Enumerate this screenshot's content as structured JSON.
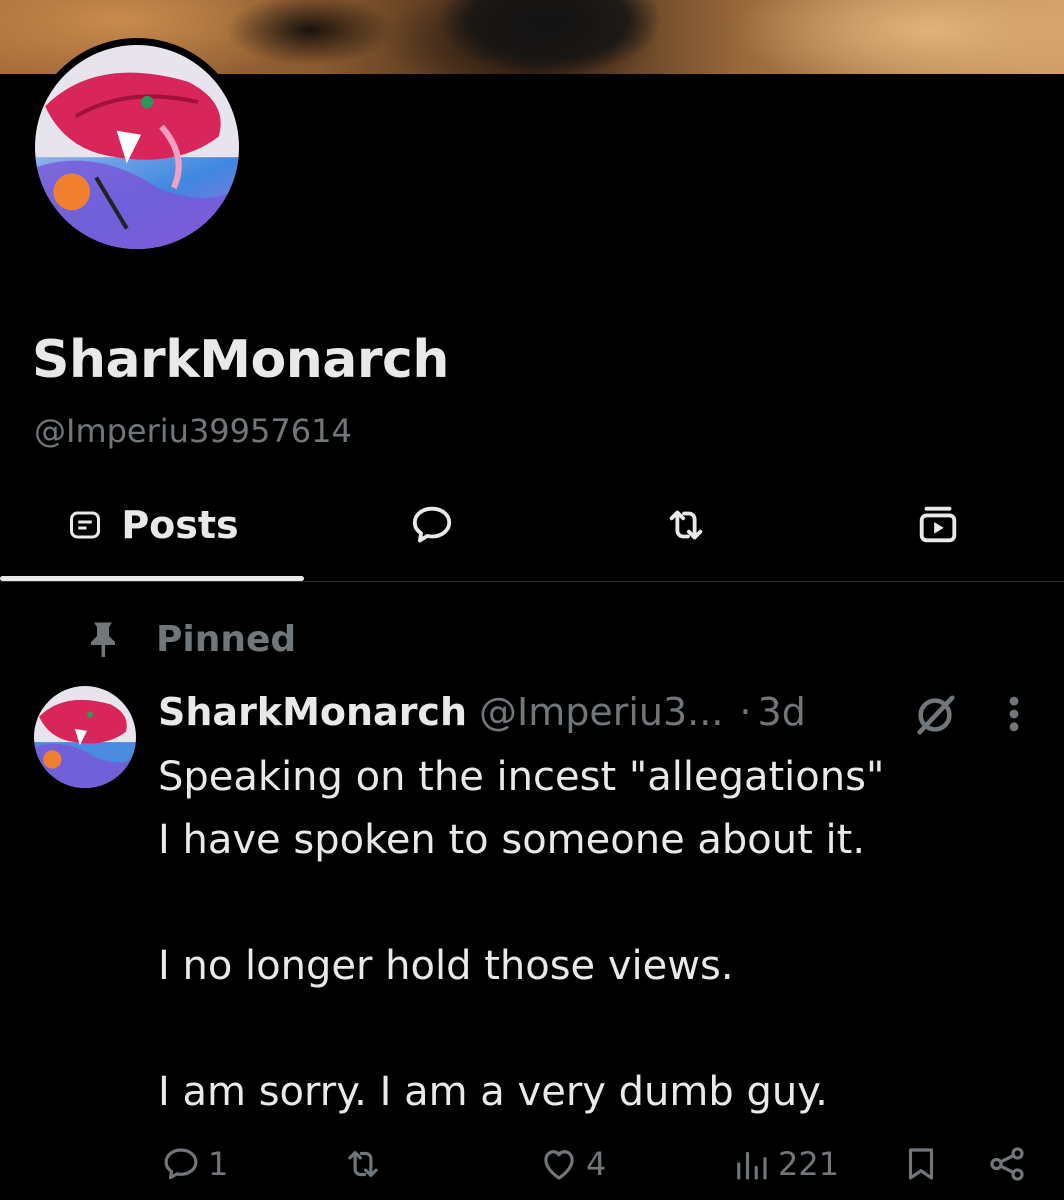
{
  "profile": {
    "display_name": "SharkMonarch",
    "handle": "@Imperiu39957614"
  },
  "tabs": [
    {
      "label": "Posts",
      "icon": "posts-icon",
      "selected": true
    },
    {
      "label": "",
      "icon": "reply-bubble-icon",
      "selected": false
    },
    {
      "label": "",
      "icon": "repost-icon",
      "selected": false
    },
    {
      "label": "",
      "icon": "media-icon",
      "selected": false
    }
  ],
  "pinned": {
    "label": "Pinned",
    "icon": "pin-icon"
  },
  "post": {
    "name": "SharkMonarch",
    "handle": "@Imperiu3...",
    "dot": "·",
    "time": "3d",
    "lines": [
      "Speaking on the incest \"allegations\"",
      "I have spoken to someone about it.",
      "",
      "I no longer hold those views.",
      "",
      "I am sorry. I am a very dumb guy."
    ],
    "stats": {
      "replies": "1",
      "reposts": "",
      "likes": "4",
      "views": "221"
    }
  },
  "colors": {
    "background": "#000000",
    "text_primary": "#e7e9ea",
    "text_secondary": "#71767b",
    "divider": "#2f3336"
  }
}
